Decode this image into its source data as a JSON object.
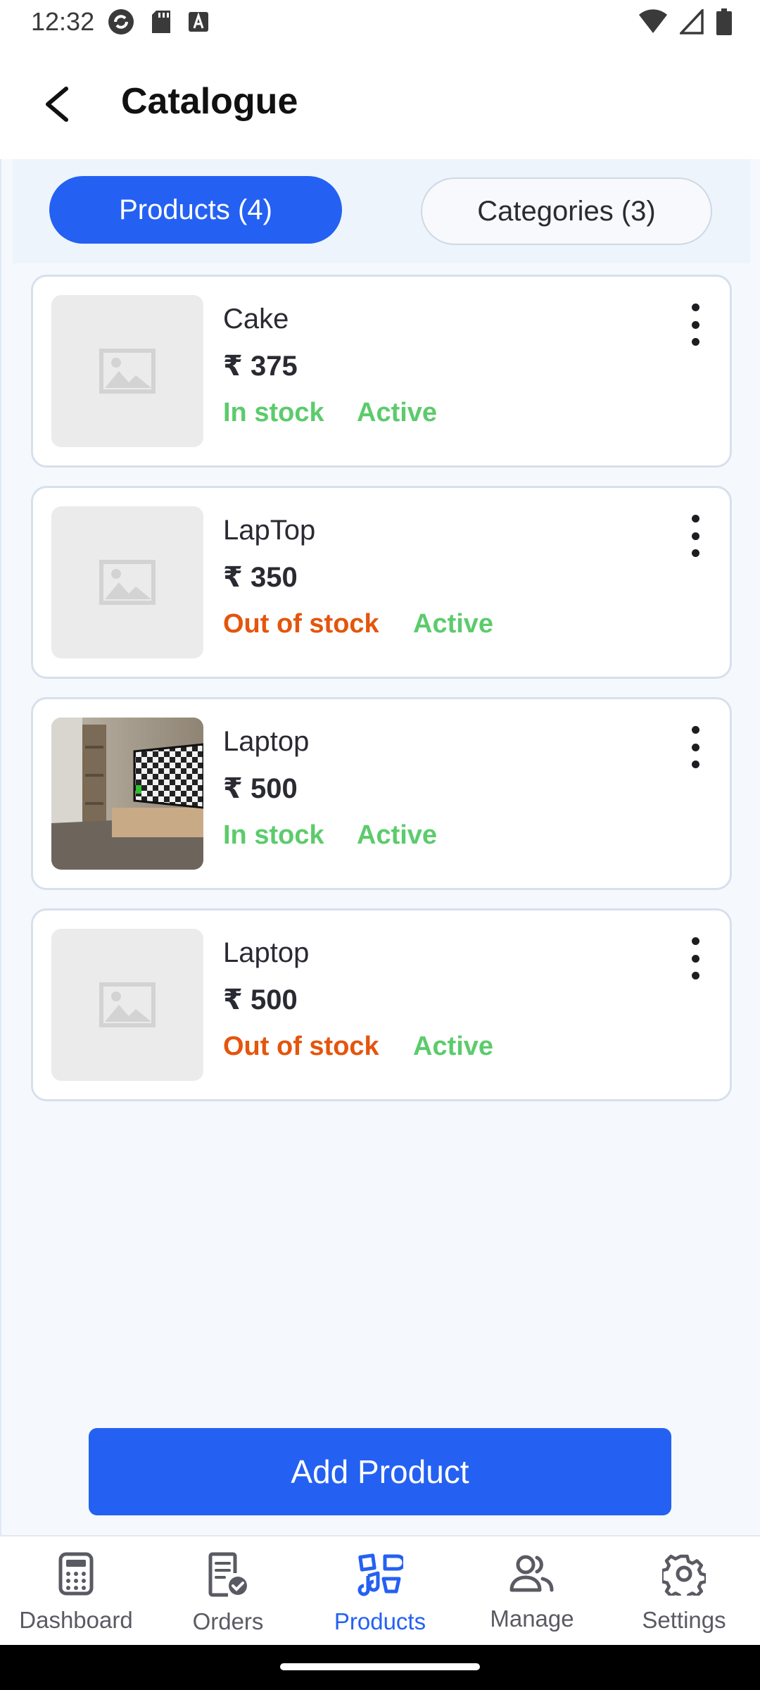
{
  "status_bar": {
    "time": "12:32"
  },
  "header": {
    "title": "Catalogue"
  },
  "tabs": [
    {
      "label": "Products (4)",
      "active": true
    },
    {
      "label": "Categories (3)",
      "active": false
    }
  ],
  "products": [
    {
      "name": "Cake",
      "price": "₹ 375",
      "stock": "In stock",
      "status": "Active",
      "image": "placeholder-image-icon"
    },
    {
      "name": "LapTop",
      "price": "₹ 350",
      "stock": "Out of stock",
      "status": "Active",
      "image": "placeholder-image-icon"
    },
    {
      "name": "Laptop",
      "price": "₹ 500",
      "stock": "In stock",
      "status": "Active",
      "image": "room-tv-photo"
    },
    {
      "name": "Laptop",
      "price": "₹ 500",
      "stock": "Out of stock",
      "status": "Active",
      "image": "placeholder-image-icon"
    }
  ],
  "actions": {
    "add_product": "Add Product"
  },
  "bottom_nav": [
    {
      "label": "Dashboard",
      "icon": "calculator-icon",
      "active": false
    },
    {
      "label": "Orders",
      "icon": "order-check-icon",
      "active": false
    },
    {
      "label": "Products",
      "icon": "products-icon",
      "active": true
    },
    {
      "label": "Manage",
      "icon": "people-icon",
      "active": false
    },
    {
      "label": "Settings",
      "icon": "gear-icon",
      "active": false
    }
  ],
  "colors": {
    "primary": "#2461f2",
    "in_stock": "#5ccb6c",
    "out_of_stock": "#e4550d",
    "active_status": "#5ccb6c"
  }
}
